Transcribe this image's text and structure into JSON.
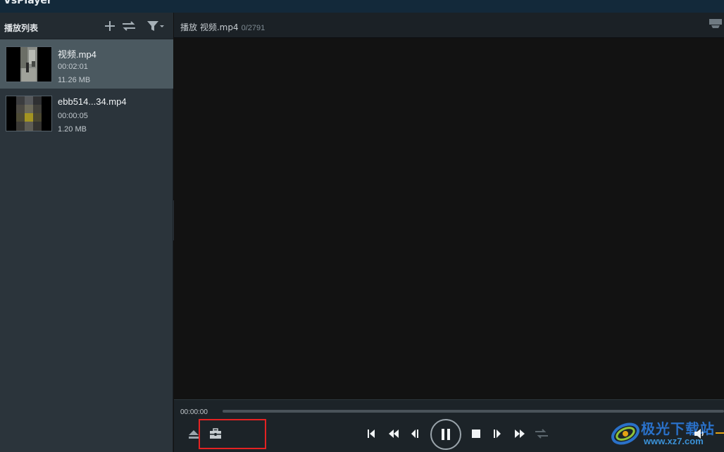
{
  "app": {
    "title": "VsPlayer"
  },
  "sidebar": {
    "title": "播放列表",
    "icons": {
      "add": "plus-icon",
      "order": "swap-icon",
      "filter": "filter-icon"
    },
    "items": [
      {
        "name": "视频.mp4",
        "duration": "00:02:01",
        "size": "11.26 MB",
        "selected": true
      },
      {
        "name": "ebb514...34.mp4",
        "duration": "00:00:05",
        "size": "1.20 MB",
        "selected": false
      }
    ]
  },
  "main": {
    "status": "播放 视频.mp4",
    "frame_counter": "0/2791"
  },
  "controls": {
    "time": "00:00:00",
    "progress": 0,
    "buttons": [
      "eject-icon",
      "toolbox-icon",
      "prev-frame-icon",
      "rewind-icon",
      "step-back-icon",
      "pause-icon",
      "stop-icon",
      "step-forward-icon",
      "fast-forward-icon",
      "repeat-icon",
      "volume-icon"
    ]
  },
  "watermark": {
    "text": "极光下载站",
    "url": "www.xz7.com"
  },
  "colors": {
    "accent": "#e4a313",
    "highlight": "#e52222",
    "panel": "#2b343b",
    "selected": "#4b5960"
  }
}
